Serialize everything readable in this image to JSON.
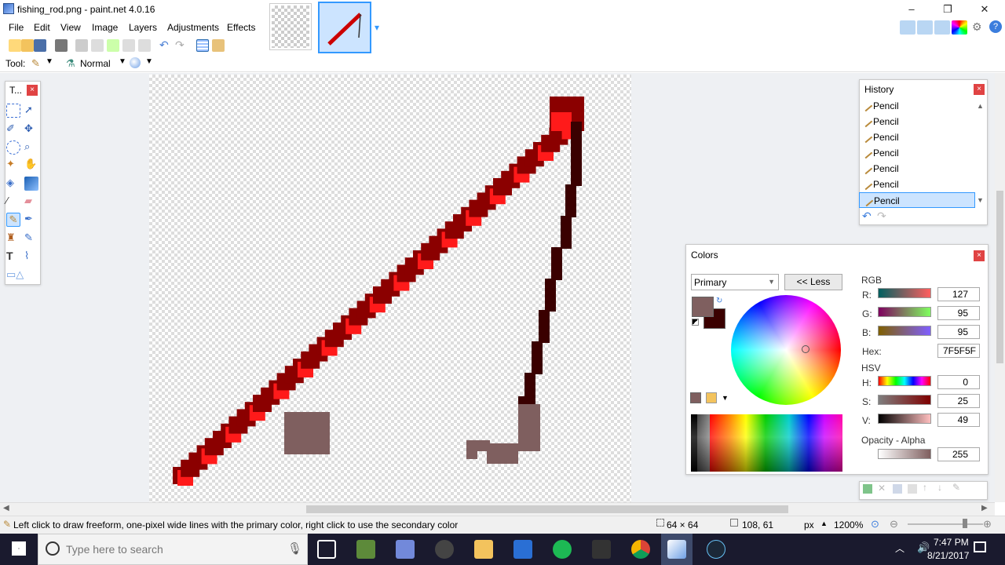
{
  "window": {
    "title": "fishing_rod.png - paint.net 4.0.16",
    "minimize": "–",
    "maximize": "❐",
    "close": "✕"
  },
  "menu": [
    "File",
    "Edit",
    "View",
    "Image",
    "Layers",
    "Adjustments",
    "Effects"
  ],
  "toolbar": {
    "tool_label": "Tool:",
    "blend_mode": "Normal"
  },
  "tools_panel": {
    "title": "T...",
    "close": "×"
  },
  "history": {
    "title": "History",
    "close": "×",
    "items": [
      "Pencil",
      "Pencil",
      "Pencil",
      "Pencil",
      "Pencil",
      "Pencil",
      "Pencil"
    ],
    "selected_index": 6
  },
  "colors": {
    "title": "Colors",
    "close": "×",
    "mode": "Primary",
    "less_button": "<< Less",
    "rgb_label": "RGB",
    "r_label": "R:",
    "g_label": "G:",
    "b_label": "B:",
    "r": "127",
    "g": "95",
    "b": "95",
    "hex_label": "Hex:",
    "hex": "7F5F5F",
    "hsv_label": "HSV",
    "h_label": "H:",
    "s_label": "S:",
    "v_label": "V:",
    "h": "0",
    "s": "25",
    "v": "49",
    "opacity_label": "Opacity - Alpha",
    "alpha": "255",
    "primary_color": "#7F5F5F",
    "secondary_color": "#3a0000"
  },
  "status": {
    "hint": "Left click to draw freeform, one-pixel wide lines with the primary color, right click to use the secondary color",
    "image_size": "64 × 64",
    "cursor_pos": "108, 61",
    "unit": "px",
    "zoom": "1200%"
  },
  "taskbar": {
    "search_placeholder": "Type here to search",
    "time": "7:47 PM",
    "date": "8/21/2017"
  },
  "pixel_art": {
    "rod_light": "#ff1a1a",
    "rod_dark": "#8b0000",
    "line_dark": "#3a0000",
    "hook_color": "#7f5f5f"
  }
}
